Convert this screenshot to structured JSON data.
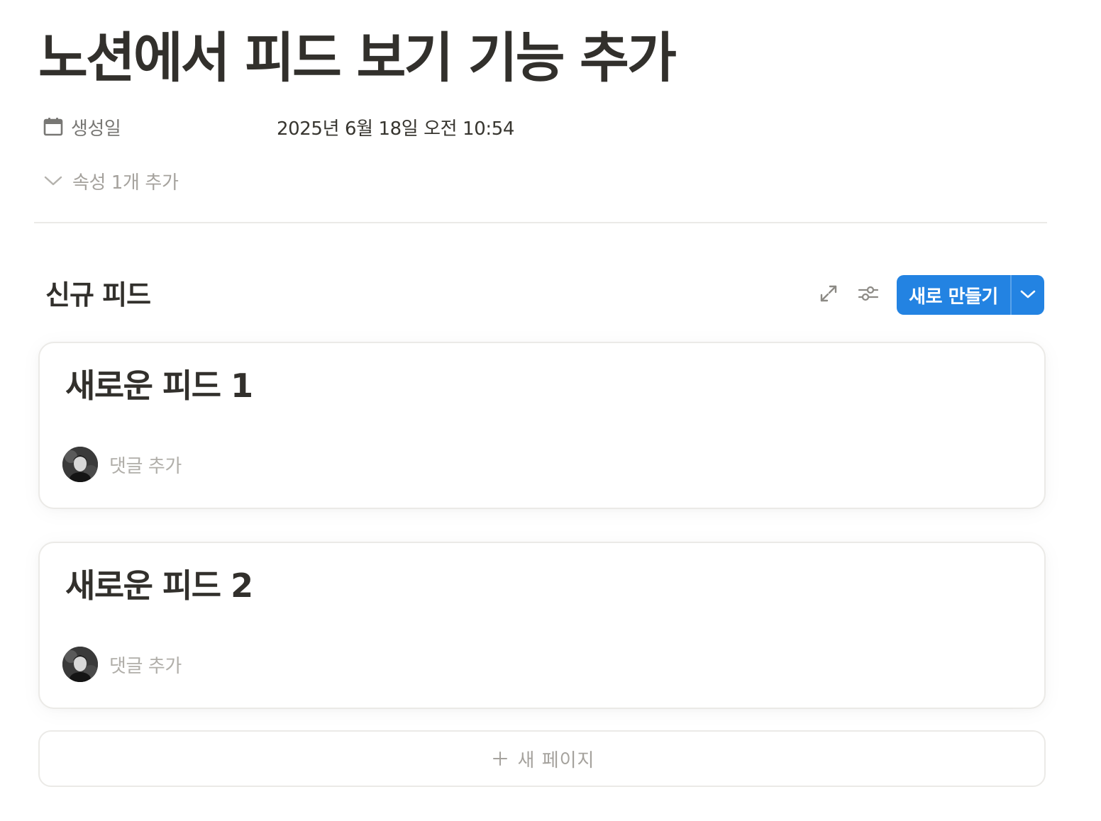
{
  "page": {
    "title": "노션에서 피드 보기 기능 추가"
  },
  "properties": {
    "created": {
      "icon": "calendar-icon",
      "name": "생성일",
      "value": "2025년 6월 18일 오전 10:54"
    },
    "more_label": "속성 1개 추가"
  },
  "view": {
    "title": "신규 피드",
    "expand_icon": "expand-icon",
    "settings_icon": "sliders-icon",
    "new_button": {
      "label": "새로 만들기",
      "dropdown_icon": "chevron-down-icon"
    }
  },
  "feed": {
    "items": [
      {
        "title": "새로운 피드 1",
        "comment_placeholder": "댓글 추가"
      },
      {
        "title": "새로운 피드 2",
        "comment_placeholder": "댓글 추가"
      }
    ],
    "new_page_label": "새 페이지"
  },
  "colors": {
    "accent": "#2383e2",
    "text": "#37352f",
    "muted": "#a5a29d",
    "border": "#ebeae7"
  }
}
